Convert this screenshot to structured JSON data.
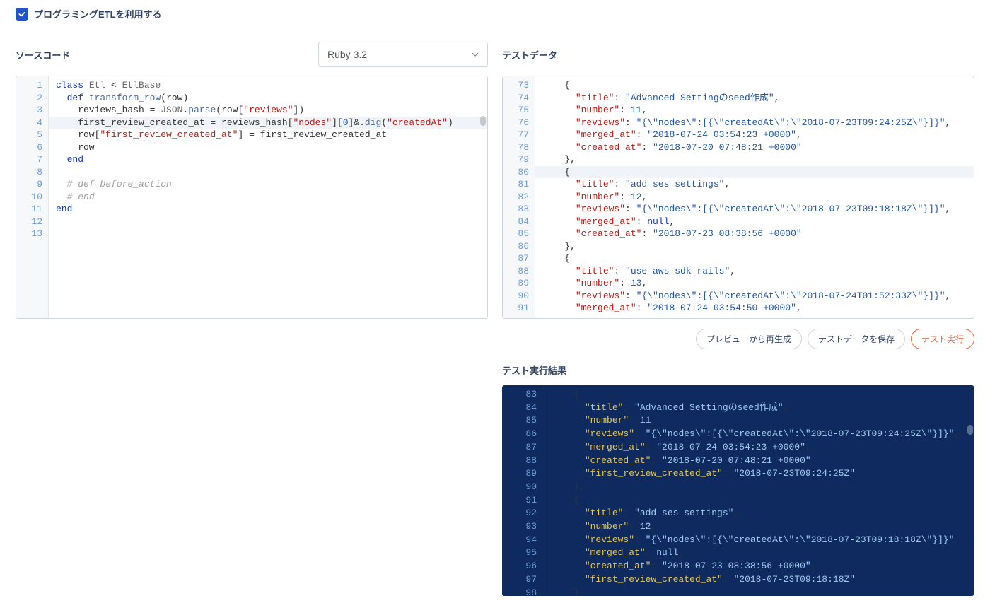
{
  "checkbox": {
    "label": "プログラミングETLを利用する",
    "checked": true
  },
  "source": {
    "title": "ソースコード",
    "runtime": "Ruby 3.2",
    "lines": [
      {
        "n": 1,
        "tokens": [
          [
            "kw",
            "class"
          ],
          [
            "op",
            " "
          ],
          [
            "cls",
            "Etl"
          ],
          [
            "op",
            " < "
          ],
          [
            "cls",
            "EtlBase"
          ]
        ]
      },
      {
        "n": 2,
        "tokens": [
          [
            "op",
            "  "
          ],
          [
            "kw",
            "def"
          ],
          [
            "op",
            " "
          ],
          [
            "fn",
            "transform_row"
          ],
          [
            "op",
            "("
          ],
          [
            "op",
            "row"
          ],
          [
            "op",
            ")"
          ]
        ]
      },
      {
        "n": 3,
        "tokens": [
          [
            "op",
            "    reviews_hash = "
          ],
          [
            "cls",
            "JSON"
          ],
          [
            "op",
            "."
          ],
          [
            "fn",
            "parse"
          ],
          [
            "op",
            "(row["
          ],
          [
            "str",
            "\"reviews\""
          ],
          [
            "op",
            "])"
          ]
        ]
      },
      {
        "n": 4,
        "hl": true,
        "tokens": [
          [
            "op",
            "    first_review_created_at = reviews_hash["
          ],
          [
            "str",
            "\"nodes\""
          ],
          [
            "op",
            "]["
          ],
          [
            "num",
            "0"
          ],
          [
            "op",
            "]&."
          ],
          [
            "fn",
            "dig"
          ],
          [
            "op",
            "("
          ],
          [
            "str",
            "\"createdAt\""
          ],
          [
            "op",
            ")"
          ]
        ]
      },
      {
        "n": 5,
        "tokens": [
          [
            "op",
            "    row["
          ],
          [
            "str",
            "\"first_review_created_at\""
          ],
          [
            "op",
            "] = first_review_created_at"
          ]
        ]
      },
      {
        "n": 6,
        "tokens": [
          [
            "op",
            "    row"
          ]
        ]
      },
      {
        "n": 7,
        "tokens": [
          [
            "op",
            "  "
          ],
          [
            "kw",
            "end"
          ]
        ]
      },
      {
        "n": 8,
        "tokens": []
      },
      {
        "n": 9,
        "tokens": [
          [
            "op",
            "  "
          ],
          [
            "cm",
            "# def before_action"
          ]
        ]
      },
      {
        "n": 10,
        "tokens": [
          [
            "op",
            "  "
          ],
          [
            "cm",
            "# end"
          ]
        ]
      },
      {
        "n": 11,
        "tokens": [
          [
            "kw",
            "end"
          ]
        ]
      },
      {
        "n": 12,
        "tokens": []
      },
      {
        "n": 13,
        "tokens": []
      }
    ]
  },
  "testData": {
    "title": "テストデータ",
    "lines": [
      {
        "n": 73,
        "tokens": [
          [
            "op",
            "    {"
          ]
        ]
      },
      {
        "n": 74,
        "tokens": [
          [
            "op",
            "      "
          ],
          [
            "json-key",
            "\"title\""
          ],
          [
            "op",
            ": "
          ],
          [
            "json-str",
            "\"Advanced Settingのseed作成\""
          ],
          [
            "op",
            ","
          ]
        ]
      },
      {
        "n": 75,
        "tokens": [
          [
            "op",
            "      "
          ],
          [
            "json-key",
            "\"number\""
          ],
          [
            "op",
            ": "
          ],
          [
            "json-num",
            "11"
          ],
          [
            "op",
            ","
          ]
        ]
      },
      {
        "n": 76,
        "tokens": [
          [
            "op",
            "      "
          ],
          [
            "json-key",
            "\"reviews\""
          ],
          [
            "op",
            ": "
          ],
          [
            "json-str",
            "\"{\\\"nodes\\\":[{\\\"createdAt\\\":\\\"2018-07-23T09:24:25Z\\\"}]}\""
          ],
          [
            "op",
            ","
          ]
        ]
      },
      {
        "n": 77,
        "tokens": [
          [
            "op",
            "      "
          ],
          [
            "json-key",
            "\"merged_at\""
          ],
          [
            "op",
            ": "
          ],
          [
            "json-str",
            "\"2018-07-24 03:54:23 +0000\""
          ],
          [
            "op",
            ","
          ]
        ]
      },
      {
        "n": 78,
        "tokens": [
          [
            "op",
            "      "
          ],
          [
            "json-key",
            "\"created_at\""
          ],
          [
            "op",
            ": "
          ],
          [
            "json-str",
            "\"2018-07-20 07:48:21 +0000\""
          ]
        ]
      },
      {
        "n": 79,
        "tokens": [
          [
            "op",
            "    },"
          ]
        ]
      },
      {
        "n": 80,
        "hl": true,
        "tokens": [
          [
            "op",
            "    {"
          ]
        ]
      },
      {
        "n": 81,
        "tokens": [
          [
            "op",
            "      "
          ],
          [
            "json-key",
            "\"title\""
          ],
          [
            "op",
            ": "
          ],
          [
            "json-str",
            "\"add ses settings\""
          ],
          [
            "op",
            ","
          ]
        ]
      },
      {
        "n": 82,
        "tokens": [
          [
            "op",
            "      "
          ],
          [
            "json-key",
            "\"number\""
          ],
          [
            "op",
            ": "
          ],
          [
            "json-num",
            "12"
          ],
          [
            "op",
            ","
          ]
        ]
      },
      {
        "n": 83,
        "tokens": [
          [
            "op",
            "      "
          ],
          [
            "json-key",
            "\"reviews\""
          ],
          [
            "op",
            ": "
          ],
          [
            "json-str",
            "\"{\\\"nodes\\\":[{\\\"createdAt\\\":\\\"2018-07-23T09:18:18Z\\\"}]}\""
          ],
          [
            "op",
            ","
          ]
        ]
      },
      {
        "n": 84,
        "tokens": [
          [
            "op",
            "      "
          ],
          [
            "json-key",
            "\"merged_at\""
          ],
          [
            "op",
            ": "
          ],
          [
            "json-null",
            "null"
          ],
          [
            "op",
            ","
          ]
        ]
      },
      {
        "n": 85,
        "tokens": [
          [
            "op",
            "      "
          ],
          [
            "json-key",
            "\"created_at\""
          ],
          [
            "op",
            ": "
          ],
          [
            "json-str",
            "\"2018-07-23 08:38:56 +0000\""
          ]
        ]
      },
      {
        "n": 86,
        "tokens": [
          [
            "op",
            "    },"
          ]
        ]
      },
      {
        "n": 87,
        "tokens": [
          [
            "op",
            "    {"
          ]
        ]
      },
      {
        "n": 88,
        "tokens": [
          [
            "op",
            "      "
          ],
          [
            "json-key",
            "\"title\""
          ],
          [
            "op",
            ": "
          ],
          [
            "json-str",
            "\"use aws-sdk-rails\""
          ],
          [
            "op",
            ","
          ]
        ]
      },
      {
        "n": 89,
        "tokens": [
          [
            "op",
            "      "
          ],
          [
            "json-key",
            "\"number\""
          ],
          [
            "op",
            ": "
          ],
          [
            "json-num",
            "13"
          ],
          [
            "op",
            ","
          ]
        ]
      },
      {
        "n": 90,
        "tokens": [
          [
            "op",
            "      "
          ],
          [
            "json-key",
            "\"reviews\""
          ],
          [
            "op",
            ": "
          ],
          [
            "json-str",
            "\"{\\\"nodes\\\":[{\\\"createdAt\\\":\\\"2018-07-24T01:52:33Z\\\"}]}\""
          ],
          [
            "op",
            ","
          ]
        ]
      },
      {
        "n": 91,
        "tokens": [
          [
            "op",
            "      "
          ],
          [
            "json-key",
            "\"merged_at\""
          ],
          [
            "op",
            ": "
          ],
          [
            "json-str",
            "\"2018-07-24 03:54:50 +0000\""
          ],
          [
            "op",
            ","
          ]
        ]
      }
    ]
  },
  "buttons": {
    "regenerate": "プレビューから再生成",
    "save": "テストデータを保存",
    "run": "テスト実行"
  },
  "result": {
    "title": "テスト実行結果",
    "lines": [
      {
        "n": 83,
        "tokens": [
          [
            "op",
            "    {"
          ]
        ]
      },
      {
        "n": 84,
        "tokens": [
          [
            "op",
            "      "
          ],
          [
            "d-key",
            "\"title\""
          ],
          [
            "op",
            ": "
          ],
          [
            "d-str",
            "\"Advanced Settingのseed作成\""
          ],
          [
            "op",
            ","
          ]
        ]
      },
      {
        "n": 85,
        "tokens": [
          [
            "op",
            "      "
          ],
          [
            "d-key",
            "\"number\""
          ],
          [
            "op",
            ": "
          ],
          [
            "d-num",
            "11"
          ],
          [
            "op",
            ","
          ]
        ]
      },
      {
        "n": 86,
        "tokens": [
          [
            "op",
            "      "
          ],
          [
            "d-key",
            "\"reviews\""
          ],
          [
            "op",
            ": "
          ],
          [
            "d-str",
            "\"{\\\"nodes\\\":[{\\\"createdAt\\\":\\\"2018-07-23T09:24:25Z\\\"}]}\""
          ],
          [
            "op",
            ","
          ]
        ]
      },
      {
        "n": 87,
        "tokens": [
          [
            "op",
            "      "
          ],
          [
            "d-key",
            "\"merged_at\""
          ],
          [
            "op",
            ": "
          ],
          [
            "d-str",
            "\"2018-07-24 03:54:23 +0000\""
          ],
          [
            "op",
            ","
          ]
        ]
      },
      {
        "n": 88,
        "tokens": [
          [
            "op",
            "      "
          ],
          [
            "d-key",
            "\"created_at\""
          ],
          [
            "op",
            ": "
          ],
          [
            "d-str",
            "\"2018-07-20 07:48:21 +0000\""
          ],
          [
            "op",
            ","
          ]
        ]
      },
      {
        "n": 89,
        "tokens": [
          [
            "op",
            "      "
          ],
          [
            "d-key",
            "\"first_review_created_at\""
          ],
          [
            "op",
            ": "
          ],
          [
            "d-str",
            "\"2018-07-23T09:24:25Z\""
          ]
        ]
      },
      {
        "n": 90,
        "tokens": [
          [
            "op",
            "    },"
          ]
        ]
      },
      {
        "n": 91,
        "tokens": [
          [
            "op",
            "    {"
          ]
        ]
      },
      {
        "n": 92,
        "tokens": [
          [
            "op",
            "      "
          ],
          [
            "d-key",
            "\"title\""
          ],
          [
            "op",
            ": "
          ],
          [
            "d-str",
            "\"add ses settings\""
          ],
          [
            "op",
            ","
          ]
        ]
      },
      {
        "n": 93,
        "tokens": [
          [
            "op",
            "      "
          ],
          [
            "d-key",
            "\"number\""
          ],
          [
            "op",
            ": "
          ],
          [
            "d-num",
            "12"
          ],
          [
            "op",
            ","
          ]
        ]
      },
      {
        "n": 94,
        "tokens": [
          [
            "op",
            "      "
          ],
          [
            "d-key",
            "\"reviews\""
          ],
          [
            "op",
            ": "
          ],
          [
            "d-str",
            "\"{\\\"nodes\\\":[{\\\"createdAt\\\":\\\"2018-07-23T09:18:18Z\\\"}]}\""
          ],
          [
            "op",
            ","
          ]
        ]
      },
      {
        "n": 95,
        "tokens": [
          [
            "op",
            "      "
          ],
          [
            "d-key",
            "\"merged_at\""
          ],
          [
            "op",
            ": "
          ],
          [
            "d-null",
            "null"
          ],
          [
            "op",
            ","
          ]
        ]
      },
      {
        "n": 96,
        "tokens": [
          [
            "op",
            "      "
          ],
          [
            "d-key",
            "\"created_at\""
          ],
          [
            "op",
            ": "
          ],
          [
            "d-str",
            "\"2018-07-23 08:38:56 +0000\""
          ],
          [
            "op",
            ","
          ]
        ]
      },
      {
        "n": 97,
        "tokens": [
          [
            "op",
            "      "
          ],
          [
            "d-key",
            "\"first_review_created_at\""
          ],
          [
            "op",
            ": "
          ],
          [
            "d-str",
            "\"2018-07-23T09:18:18Z\""
          ]
        ]
      },
      {
        "n": 98,
        "tokens": [
          [
            "op",
            "    },"
          ]
        ]
      }
    ]
  }
}
